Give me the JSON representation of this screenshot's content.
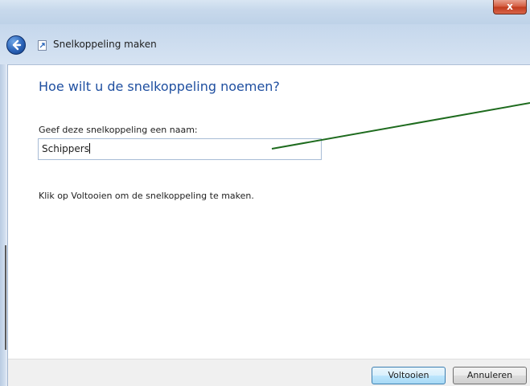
{
  "window": {
    "title": "Snelkoppeling maken",
    "close_glyph": "x"
  },
  "content": {
    "heading": "Hoe wilt u de snelkoppeling noemen?",
    "name_label": "Geef deze snelkoppeling een naam:",
    "name_value": "Schippers",
    "instruction": "Klik op Voltooien om de snelkoppeling te maken."
  },
  "footer": {
    "finish_label": "Voltooien",
    "cancel_label": "Annuleren"
  },
  "icons": {
    "back": "back-arrow-icon",
    "wizard": "shortcut-wizard-icon",
    "close": "close-icon"
  },
  "colors": {
    "heading": "#1f4fa0",
    "annotation_line": "#1e6b1e",
    "close_button": "#c8442a"
  }
}
